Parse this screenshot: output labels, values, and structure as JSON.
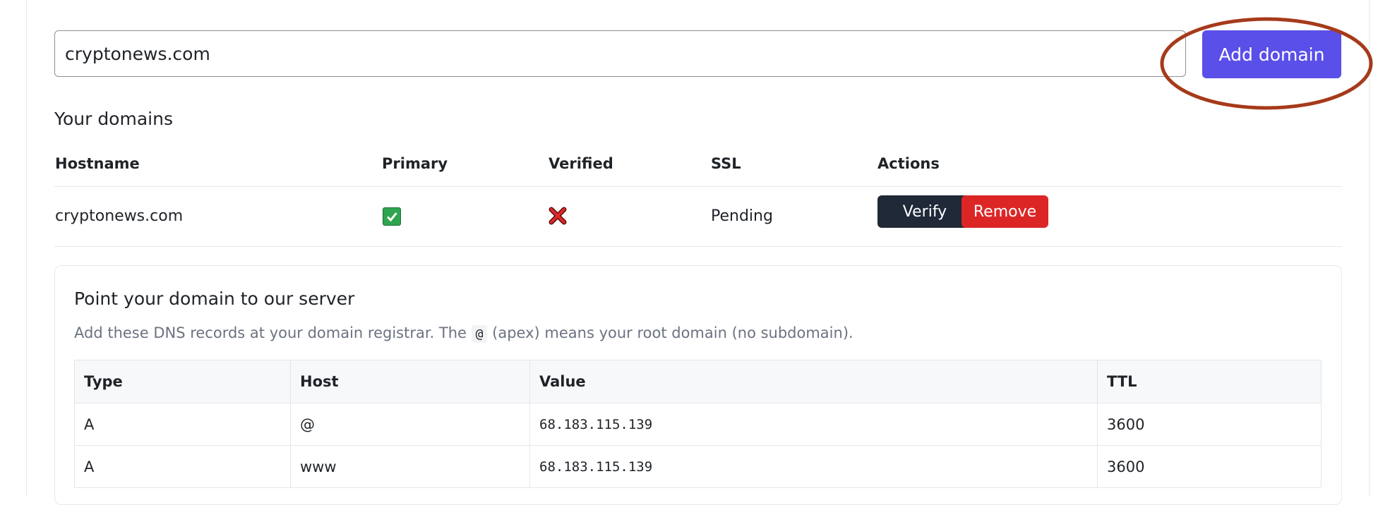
{
  "add_form": {
    "domain_value": "cryptonews.com",
    "add_button_label": "Add domain",
    "accent_color": "#5a4fe8",
    "annotation_color": "#a63a1a"
  },
  "domains": {
    "section_title": "Your domains",
    "headers": [
      "Hostname",
      "Primary",
      "Verified",
      "SSL",
      "Actions"
    ],
    "rows": [
      {
        "hostname": "cryptonews.com",
        "primary_icon": "checkbox-checked-icon",
        "verified_icon": "red-x-icon",
        "ssl": "Pending",
        "verify_label": "Verify",
        "remove_label": "Remove"
      }
    ]
  },
  "dns_card": {
    "title": "Point your domain to our server",
    "description_before": "Add these DNS records at your domain registrar. The ",
    "description_code": "@",
    "description_after": " (apex) means your root domain (no subdomain).",
    "headers": [
      "Type",
      "Host",
      "Value",
      "TTL"
    ],
    "rows": [
      {
        "type": "A",
        "host": "@",
        "value": "68.183.115.139",
        "ttl": "3600"
      },
      {
        "type": "A",
        "host": "www",
        "value": "68.183.115.139",
        "ttl": "3600"
      }
    ]
  }
}
